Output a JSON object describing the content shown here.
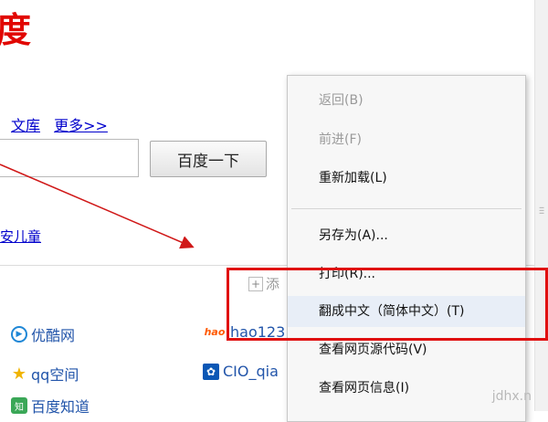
{
  "page": {
    "logo_text": "度",
    "nav_links": [
      "文库",
      "更多>>"
    ],
    "search_button_label": "百度一下",
    "safe_link": "安儿童",
    "add_text": "添"
  },
  "sites": [
    {
      "label": "优酷网",
      "icon": "youku-icon"
    },
    {
      "label": "qq空间",
      "icon": "star-icon"
    },
    {
      "label": "百度知道",
      "icon": "zhidao-icon"
    },
    {
      "label": "hao123",
      "icon": "hao123-icon"
    },
    {
      "label": "CIO_qia",
      "icon": "paw-icon"
    }
  ],
  "context_menu": {
    "items": [
      {
        "label": "返回(B)",
        "disabled": true
      },
      {
        "label": "前进(F)",
        "disabled": true
      },
      {
        "label": "重新加载(L)",
        "disabled": false
      },
      {
        "label": "另存为(A)...",
        "disabled": false
      },
      {
        "label": "打印(R)...",
        "disabled": false
      },
      {
        "label": "翻成中文（简体中文）(T)",
        "disabled": false
      },
      {
        "label": "查看网页源代码(V)",
        "disabled": false
      },
      {
        "label": "查看网页信息(I)",
        "disabled": false
      }
    ]
  },
  "watermark": "jdhx.n",
  "colors": {
    "logo_red": "#e10601",
    "link_blue": "#0000cc",
    "highlight_red": "#e01010",
    "arrow_red": "#d01818"
  }
}
